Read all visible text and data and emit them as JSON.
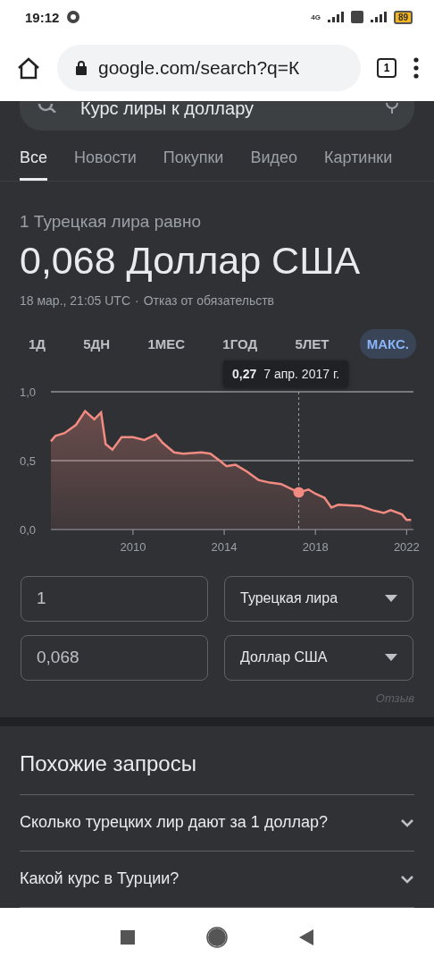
{
  "status_bar": {
    "time": "19:12",
    "network": "4G",
    "battery": "89"
  },
  "browser": {
    "url": "google.com/search?q=К",
    "tab_count": "1"
  },
  "search": {
    "query": "Курс лиры к доллару"
  },
  "tabs": [
    {
      "label": "Все",
      "selected": true
    },
    {
      "label": "Новости",
      "selected": false
    },
    {
      "label": "Покупки",
      "selected": false
    },
    {
      "label": "Видео",
      "selected": false
    },
    {
      "label": "Картинки",
      "selected": false
    }
  ],
  "converter": {
    "subtitle": "1 Турецкая лира равно",
    "result": "0,068 Доллар США",
    "timestamp": "18 мар., 21:05 UTC",
    "separator": "·",
    "disclaimer": "Отказ от обязательств",
    "ranges": [
      {
        "label": "1Д",
        "selected": false
      },
      {
        "label": "5ДН",
        "selected": false
      },
      {
        "label": "1МЕС",
        "selected": false
      },
      {
        "label": "1ГОД",
        "selected": false
      },
      {
        "label": "5ЛЕТ",
        "selected": false
      },
      {
        "label": "МАКС.",
        "selected": true
      }
    ],
    "chart_data": {
      "type": "area",
      "x": [
        2006.4,
        2006.6,
        2007,
        2007.5,
        2007.9,
        2008.3,
        2008.6,
        2008.8,
        2009.1,
        2009.5,
        2010,
        2010.5,
        2011,
        2011.3,
        2011.8,
        2012.2,
        2013,
        2013.4,
        2013.8,
        2014.1,
        2014.5,
        2015,
        2015.5,
        2016,
        2016.5,
        2017,
        2017.27,
        2017.7,
        2018,
        2018.4,
        2018.7,
        2019,
        2020,
        2020.5,
        2021,
        2021.3,
        2021.8,
        2022,
        2022.2
      ],
      "series": [
        {
          "color": "#f28b82",
          "values": [
            0.64,
            0.68,
            0.7,
            0.76,
            0.86,
            0.8,
            0.85,
            0.62,
            0.58,
            0.67,
            0.67,
            0.65,
            0.69,
            0.63,
            0.56,
            0.55,
            0.56,
            0.55,
            0.5,
            0.46,
            0.47,
            0.42,
            0.36,
            0.34,
            0.33,
            0.29,
            0.27,
            0.29,
            0.26,
            0.23,
            0.16,
            0.18,
            0.17,
            0.14,
            0.12,
            0.14,
            0.11,
            0.07,
            0.07
          ]
        }
      ],
      "xlim": [
        2006.4,
        2022.3
      ],
      "ylim": [
        0,
        1
      ],
      "xticks": [
        2010,
        2014,
        2018,
        2022
      ],
      "yticks": [
        {
          "value": 0,
          "label": "0,0"
        },
        {
          "value": 0.5,
          "label": "0,5"
        },
        {
          "value": 1,
          "label": "1,0"
        }
      ],
      "ref_lines": [
        {
          "axis": "x",
          "value": 2017.27
        }
      ]
    },
    "tooltip": {
      "value": "0,27",
      "date": "7 апр. 2017 г."
    },
    "fields": [
      {
        "value": "1",
        "currency": "Турецкая лира"
      },
      {
        "value": "0,068",
        "currency": "Доллар США"
      }
    ],
    "feedback": "Отзыв"
  },
  "related": {
    "title": "Похожие запросы",
    "items": [
      {
        "text": "Сколько турецких лир дают за 1 доллар?",
        "expanded": false
      },
      {
        "text": "Какой курс в Турции?",
        "expanded": false
      }
    ]
  }
}
